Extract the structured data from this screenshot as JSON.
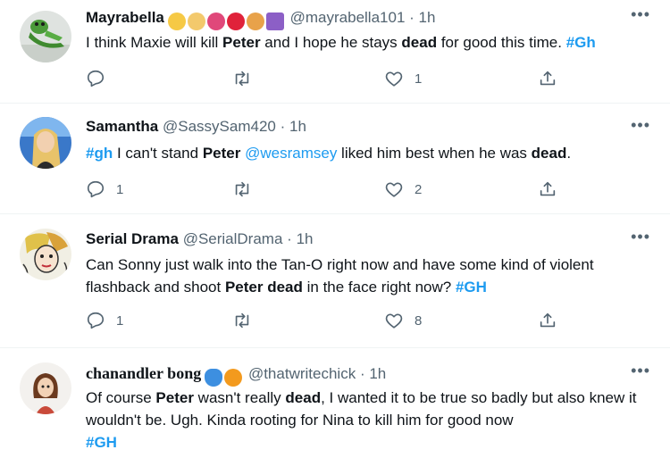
{
  "colors": {
    "link": "#1d9bf0",
    "secondary": "#536471",
    "text": "#0f1419",
    "divider": "#eff3f4"
  },
  "tweets": [
    {
      "display_name": "Mayrabella",
      "emojis": [
        "mask-face",
        "person-laptop",
        "dancer",
        "red-heart",
        "weightlifter",
        "virgo-sign"
      ],
      "handle": "@mayrabella101",
      "dot": "·",
      "time": "1h",
      "more": "•••",
      "text": [
        "I think Maxie will kill ",
        "Peter",
        " and I hope he stays ",
        "dead",
        " for good this time. ",
        "#Gh"
      ],
      "reply_count": "",
      "retweet_count": "",
      "like_count": "1"
    },
    {
      "display_name": "Samantha",
      "handle": "@SassySam420",
      "dot": "·",
      "time": "1h",
      "more": "•••",
      "text": [
        "#gh",
        " I can't stand ",
        "Peter",
        " ",
        "@wesramsey",
        " liked him best when he was ",
        "dead",
        "."
      ],
      "reply_count": "1",
      "retweet_count": "",
      "like_count": "2"
    },
    {
      "display_name": "Serial Drama",
      "handle": "@SerialDrama",
      "dot": "·",
      "time": "1h",
      "more": "•••",
      "text": [
        "Can Sonny just walk into the Tan-O right now and have some kind of violent flashback and shoot ",
        "Peter dead",
        " in the face right now? ",
        "#GH"
      ],
      "reply_count": "1",
      "retweet_count": "",
      "like_count": "8"
    },
    {
      "display_name": "chanandler bong",
      "emojis": [
        "blue-butterfly",
        "orange-heart"
      ],
      "handle": "@thatwritechick",
      "dot": "·",
      "time": "1h",
      "more": "•••",
      "text": [
        "Of course ",
        "Peter",
        " wasn't really ",
        "dead",
        ", I wanted it to be true so badly but also knew it wouldn't be. Ugh. Kinda rooting for Nina to kill him for good now",
        "#GH"
      ]
    }
  ]
}
